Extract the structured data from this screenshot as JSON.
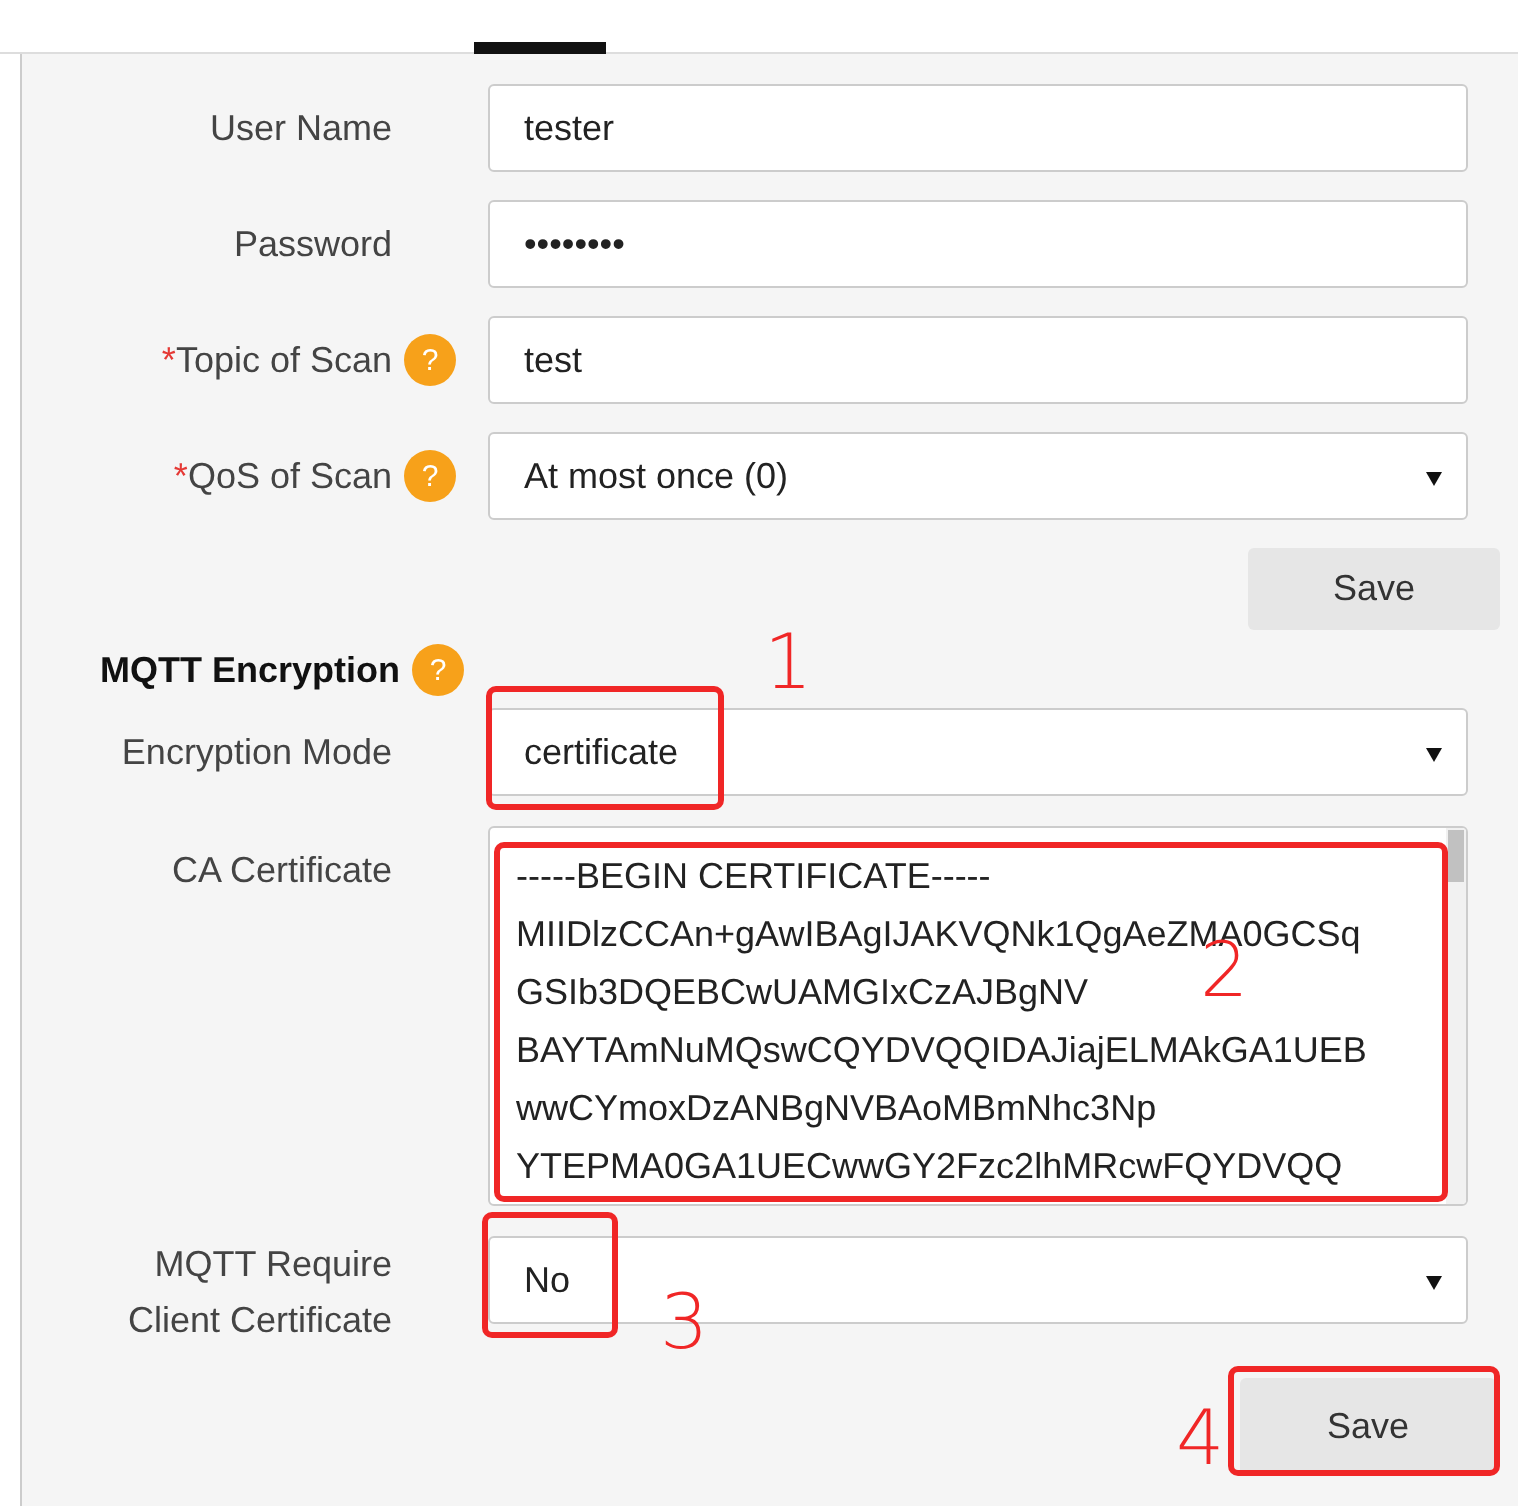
{
  "fields": [
    {
      "kind": "text",
      "label": "User Name",
      "value": "tester"
    },
    {
      "kind": "text",
      "label": "Password",
      "value": "••••••••"
    },
    {
      "kind": "text",
      "label": "Topic of Scan",
      "required_mark": "*",
      "help": "?",
      "value": "test"
    },
    {
      "kind": "select",
      "label": "QoS of Scan",
      "required_mark": "*",
      "help": "?",
      "value": "At most once (0)"
    }
  ],
  "save_button": "Save",
  "encryption": {
    "title": "MQTT Encryption",
    "help": "?",
    "fields": [
      {
        "kind": "select",
        "label": "Encryption Mode",
        "value": "certificate"
      },
      {
        "kind": "textarea",
        "label": "CA Certificate",
        "lines": [
          "-----BEGIN CERTIFICATE-----",
          "MIIDlzCCAn+gAwIBAgIJAKVQNk1QgAeZMA0GCSq",
          "GSIb3DQEBCwUAMGIxCzAJBgNV",
          "BAYTAmNuMQswCQYDVQQIDAJiajELMAkGA1UEB",
          "wwCYmoxDzANBgNVBAoMBmNhc3Np",
          "YTEPMA0GA1UECwwGY2Fzc2lhMRcwFQYDVQQ"
        ]
      },
      {
        "kind": "select",
        "label": "MQTT Require Client Certificate",
        "value": "No"
      }
    ],
    "save_button": "Save"
  },
  "annotations": [
    {
      "number": "1"
    },
    {
      "number": "2"
    },
    {
      "number": "3"
    },
    {
      "number": "4"
    }
  ]
}
